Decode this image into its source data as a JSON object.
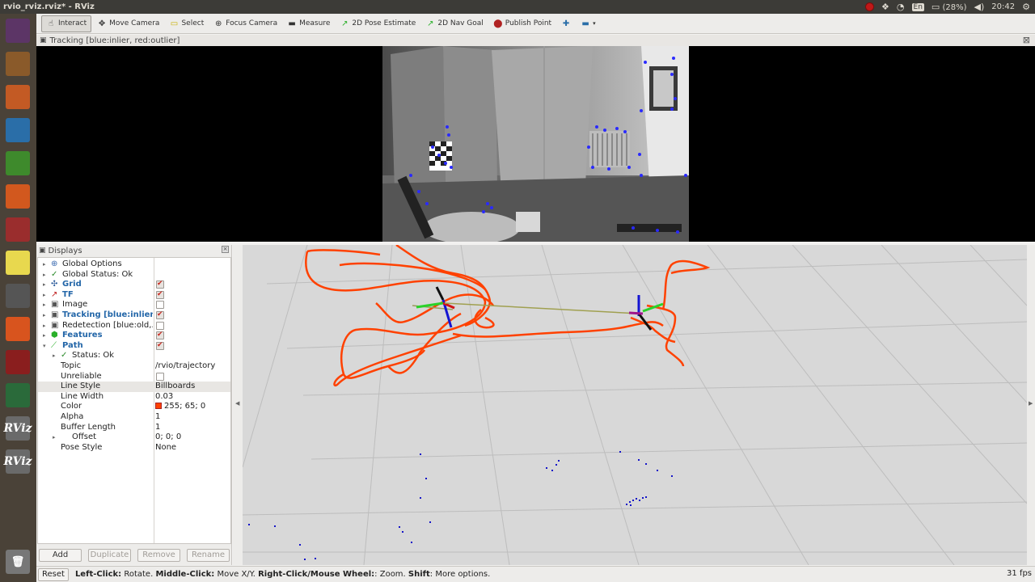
{
  "window": {
    "title": "rvio_rviz.rviz* - RViz"
  },
  "top_panel": {
    "keyboard_layout": "En",
    "battery": "(28%)",
    "clock": "20:42"
  },
  "launcher": {
    "items": [
      {
        "name": "dash-icon",
        "color": "#5c3566"
      },
      {
        "name": "files-icon",
        "color": "#8a5a2a"
      },
      {
        "name": "impress-icon",
        "color": "#c35a24"
      },
      {
        "name": "image-viewer-icon",
        "color": "#2a6ea8"
      },
      {
        "name": "calc-icon",
        "color": "#3e8a2c"
      },
      {
        "name": "software-center-icon",
        "color": "#d2581e"
      },
      {
        "name": "settings-icon",
        "color": "#9a2d2d"
      },
      {
        "name": "notes-icon",
        "color": "#e8d84e"
      },
      {
        "name": "text-editor-icon",
        "color": "#555"
      },
      {
        "name": "firefox-icon",
        "color": "#d8541e"
      },
      {
        "name": "terminal-red-icon",
        "color": "#8a1e1e"
      },
      {
        "name": "globe-icon",
        "color": "#2a6a3a"
      },
      {
        "name": "rviz-icon-1",
        "color": "#6a6a6a",
        "label": "RViz"
      },
      {
        "name": "rviz-icon-2",
        "color": "#6a6a6a",
        "label": "RViz"
      }
    ]
  },
  "toolbar": {
    "tools": [
      {
        "name": "interact-tool",
        "label": "Interact",
        "icon": "☝",
        "active": true
      },
      {
        "name": "move-camera-tool",
        "label": "Move Camera",
        "icon": "✥",
        "active": false
      },
      {
        "name": "select-tool",
        "label": "Select",
        "icon": "▭",
        "active": false
      },
      {
        "name": "focus-camera-tool",
        "label": "Focus Camera",
        "icon": "⊕",
        "active": false
      },
      {
        "name": "measure-tool",
        "label": "Measure",
        "icon": "▬",
        "active": false
      },
      {
        "name": "pose-estimate-tool",
        "label": "2D Pose Estimate",
        "icon": "↗",
        "active": false
      },
      {
        "name": "nav-goal-tool",
        "label": "2D Nav Goal",
        "icon": "↗",
        "active": false
      },
      {
        "name": "publish-point-tool",
        "label": "Publish Point",
        "icon": "⬤",
        "active": false
      }
    ]
  },
  "tracking_panel": {
    "title": "Tracking [blue:inlier, red:outlier]"
  },
  "displays_panel": {
    "title": "Displays",
    "rows": [
      {
        "indent": 0,
        "arrow": "▸",
        "icon": "globe",
        "label": "Global Options",
        "bold": false,
        "check": null,
        "value": ""
      },
      {
        "indent": 0,
        "arrow": "▸",
        "icon": "tick",
        "label": "Global Status: Ok",
        "bold": false,
        "check": null,
        "value": ""
      },
      {
        "indent": 0,
        "arrow": "▸",
        "icon": "grid",
        "label": "Grid",
        "bold": true,
        "check": true,
        "value": ""
      },
      {
        "indent": 0,
        "arrow": "▸",
        "icon": "tf",
        "label": "TF",
        "bold": true,
        "check": true,
        "value": ""
      },
      {
        "indent": 0,
        "arrow": "▸",
        "icon": "image",
        "label": "Image",
        "bold": false,
        "check": false,
        "value": ""
      },
      {
        "indent": 0,
        "arrow": "▸",
        "icon": "image",
        "label": "Tracking [blue:inlier, ...",
        "bold": true,
        "check": true,
        "value": ""
      },
      {
        "indent": 0,
        "arrow": "▸",
        "icon": "image",
        "label": "Redetection [blue:old,...",
        "bold": false,
        "check": false,
        "value": ""
      },
      {
        "indent": 0,
        "arrow": "▸",
        "icon": "features",
        "label": "Features",
        "bold": true,
        "check": true,
        "value": ""
      },
      {
        "indent": 0,
        "arrow": "▾",
        "icon": "path",
        "label": "Path",
        "bold": true,
        "check": true,
        "value": ""
      },
      {
        "indent": 1,
        "arrow": "▸",
        "icon": "tick",
        "label": "Status: Ok",
        "bold": false,
        "check": null,
        "value": ""
      },
      {
        "indent": 2,
        "arrow": "",
        "icon": "",
        "label": "Topic",
        "bold": false,
        "check": null,
        "value": "/rvio/trajectory"
      },
      {
        "indent": 2,
        "arrow": "",
        "icon": "",
        "label": "Unreliable",
        "bold": false,
        "check": false,
        "value": ""
      },
      {
        "indent": 2,
        "arrow": "",
        "icon": "",
        "label": "Line Style",
        "bold": false,
        "check": null,
        "value": "Billboards",
        "selected": true
      },
      {
        "indent": 2,
        "arrow": "",
        "icon": "",
        "label": "Line Width",
        "bold": false,
        "check": null,
        "value": "0.03"
      },
      {
        "indent": 2,
        "arrow": "",
        "icon": "",
        "label": "Color",
        "bold": false,
        "check": null,
        "value": "255; 65; 0",
        "swatch": true
      },
      {
        "indent": 2,
        "arrow": "",
        "icon": "",
        "label": "Alpha",
        "bold": false,
        "check": null,
        "value": "1"
      },
      {
        "indent": 2,
        "arrow": "",
        "icon": "",
        "label": "Buffer Length",
        "bold": false,
        "check": null,
        "value": "1"
      },
      {
        "indent": 1,
        "arrow": "▸",
        "icon": "",
        "label": "Offset",
        "bold": false,
        "check": null,
        "value": "0; 0; 0"
      },
      {
        "indent": 2,
        "arrow": "",
        "icon": "",
        "label": "Pose Style",
        "bold": false,
        "check": null,
        "value": "None"
      }
    ],
    "buttons": {
      "add": "Add",
      "duplicate": "Duplicate",
      "remove": "Remove",
      "rename": "Rename"
    }
  },
  "path_color": "#ff4100",
  "statusbar": {
    "reset": "Reset",
    "help": [
      {
        "bold": "Left-Click:",
        "text": " Rotate. "
      },
      {
        "bold": "Middle-Click:",
        "text": " Move X/Y. "
      },
      {
        "bold": "Right-Click/Mouse Wheel:",
        "text": ": Zoom. "
      },
      {
        "bold": "Shift",
        "text": ": More options."
      }
    ],
    "fps": "31 fps"
  }
}
